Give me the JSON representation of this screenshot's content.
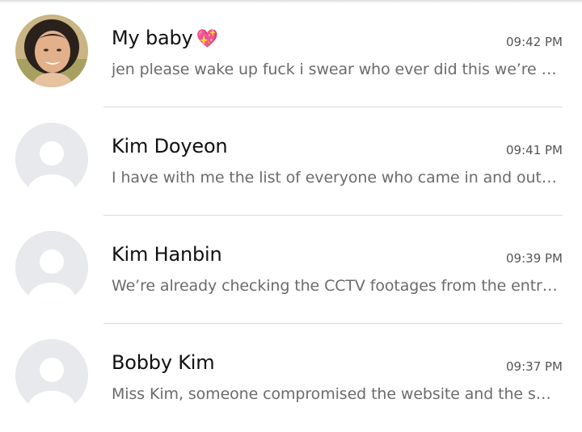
{
  "conversations": [
    {
      "name": "My baby",
      "emoji": "💖",
      "time": "09:42 PM",
      "preview": "jen please wake up fuck i swear who ever did this we’re going to find them",
      "avatar": "photo"
    },
    {
      "name": "Kim Doyeon",
      "time": "09:41 PM",
      "preview": "I have with me the list of everyone who came in and out of the building",
      "avatar": "default-person-icon"
    },
    {
      "name": "Kim Hanbin",
      "time": "09:39 PM",
      "preview": "We’re already checking the CCTV footages from the entrance",
      "avatar": "default-person-icon"
    },
    {
      "name": "Bobby Kim",
      "time": "09:37 PM",
      "preview": "Miss Kim, someone compromised the website and the server",
      "avatar": "default-person-icon"
    }
  ],
  "colors": {
    "avatar_bg": "#e7e9ec",
    "avatar_fg": "#ffffff",
    "divider": "#d9d9d9",
    "name_text": "#111111",
    "preview_text": "#6b6b6b",
    "time_text": "#555555"
  }
}
